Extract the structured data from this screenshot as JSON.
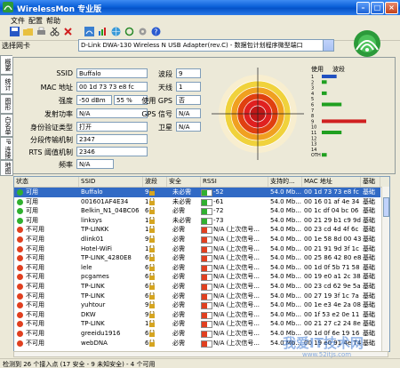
{
  "window": {
    "title": "WirelessMon 专业版",
    "min": "–",
    "max": "□",
    "close": "×"
  },
  "menu": [
    "文件",
    "配置",
    "帮助"
  ],
  "toolbar": {
    "icons": [
      "save-icon",
      "folder-icon",
      "print-icon",
      "scissors-icon",
      "copy-icon",
      "paste-icon",
      "delete-icon",
      "wifi-icon",
      "refresh-icon",
      "globe-icon",
      "gear-icon",
      "help-icon"
    ]
  },
  "adapter": {
    "label": "选择网卡",
    "value": "D-Link DWA-130 Wireless N USB Adapter(rev.C) - 数据包计划程序微型端口"
  },
  "tabs": [
    "概要",
    "统计",
    "图形",
    "白名单",
    "IP 连接",
    "地图"
  ],
  "fields": {
    "ssid_label": "SSID",
    "ssid": "Buffalo",
    "mac_label": "MAC 地址",
    "mac": "00 1d 73 73 e8 fc",
    "strength_label": "强度",
    "strength_dbm": "-50 dBm",
    "strength_pct": "55 %",
    "tx_label": "发射功率",
    "tx": "N/A",
    "auth_label": "身份验证类型",
    "auth": "打开",
    "frag_label": "分段传输机制",
    "frag": "2347",
    "rts_label": "RTS 阈值机制",
    "rts": "2346",
    "freq_label": "频率",
    "freq": "N/A",
    "channel_label": "波段",
    "channel": "9",
    "antenna_label": "天线",
    "antenna": "1",
    "gps_label": "使用 GPS",
    "gps": "否",
    "gpssig_label": "GPS 信号",
    "gpssig": "N/A",
    "sat_label": "卫星",
    "sat": "N/A"
  },
  "channel_chart": {
    "header_use": "使用",
    "header_band": "波段",
    "channels": [
      "1",
      "2",
      "3",
      "4",
      "5",
      "6",
      "7",
      "8",
      "9",
      "10",
      "11",
      "12",
      "13",
      "14",
      "OTH"
    ],
    "usage": [
      3,
      1,
      0,
      1,
      0,
      4,
      0,
      0,
      9,
      0,
      4,
      0,
      0,
      0,
      1
    ],
    "colors": [
      "#2050c0",
      "#20a020",
      "#20a020",
      "#20a020",
      "#20a020",
      "#20a020",
      "#20a020",
      "#20a020",
      "#d02020",
      "#20a020",
      "#20a020",
      "#20a020",
      "#20a020",
      "#20a020",
      "#20a020"
    ]
  },
  "grid": {
    "headers": [
      "状态",
      "SSID",
      "波段",
      "安全",
      "RSSI",
      "支持的...",
      "MAC 地址",
      "基础"
    ],
    "rows": [
      {
        "status": "可用",
        "color": "#30b030",
        "ssid": "Buffalo",
        "ch": "9",
        "sec": "未必需",
        "rssi": "-52",
        "rate": "54.0 Mb...",
        "mac": "00 1d 73 73 e8 fc",
        "mode": "基础",
        "bar": "#30b030",
        "sel": true
      },
      {
        "status": "可用",
        "color": "#30b030",
        "ssid": "001601AF4E34",
        "ch": "1",
        "sec": "未必需",
        "rssi": "-61",
        "rate": "54.0 Mb...",
        "mac": "00 16 01 af 4e 34",
        "mode": "基础",
        "bar": "#30b030"
      },
      {
        "status": "可用",
        "color": "#30b030",
        "ssid": "Belkin_N1_04BC06",
        "ch": "6",
        "sec": "必需",
        "rssi": "-72",
        "rate": "54.0 Mb...",
        "mac": "00 1c df 04 bc 06",
        "mode": "基础",
        "bar": "#30b030"
      },
      {
        "status": "可用",
        "color": "#30b030",
        "ssid": "linksys",
        "ch": "11",
        "sec": "未必需",
        "rssi": "-73",
        "rate": "54.0 Mb...",
        "mac": "00 21 29 b1 c9 9d",
        "mode": "基础",
        "bar": "#30b030"
      },
      {
        "status": "不可用",
        "color": "#e04020",
        "ssid": "TP-LINKK",
        "ch": "1",
        "sec": "必需",
        "rssi": "N/A (上次信号...",
        "rate": "54.0 Mb...",
        "mac": "00 23 cd 4d 4f 6c",
        "mode": "基础",
        "bar": "#e04020"
      },
      {
        "status": "不可用",
        "color": "#e04020",
        "ssid": "dlink01",
        "ch": "9",
        "sec": "必需",
        "rssi": "N/A (上次信号...",
        "rate": "54.0 Mb...",
        "mac": "00 1e 58 8d 00 43",
        "mode": "基础",
        "bar": "#e04020"
      },
      {
        "status": "不可用",
        "color": "#e04020",
        "ssid": "Hotel-WiFi",
        "ch": "11",
        "sec": "必需",
        "rssi": "N/A (上次信号...",
        "rate": "54.0 Mb...",
        "mac": "00 21 91 9d 3f 1c",
        "mode": "基础",
        "bar": "#e04020"
      },
      {
        "status": "不可用",
        "color": "#e04020",
        "ssid": "TP-LINK_4280E8",
        "ch": "6",
        "sec": "必需",
        "rssi": "N/A (上次信号...",
        "rate": "54.0 Mb...",
        "mac": "00 25 86 42 80 e8",
        "mode": "基础",
        "bar": "#e04020"
      },
      {
        "status": "不可用",
        "color": "#e04020",
        "ssid": "lele",
        "ch": "6",
        "sec": "必需",
        "rssi": "N/A (上次信号...",
        "rate": "54.0 Mb...",
        "mac": "00 1d 0f 5b 71 58",
        "mode": "基础",
        "bar": "#e04020"
      },
      {
        "status": "不可用",
        "color": "#e04020",
        "ssid": "pcgames",
        "ch": "6",
        "sec": "必需",
        "rssi": "N/A (上次信号...",
        "rate": "54.0 Mb...",
        "mac": "00 19 e0 a1 2c 38",
        "mode": "基础",
        "bar": "#e04020"
      },
      {
        "status": "不可用",
        "color": "#e04020",
        "ssid": "TP-LINK",
        "ch": "6",
        "sec": "必需",
        "rssi": "N/A (上次信号...",
        "rate": "54.0 Mb...",
        "mac": "00 23 cd 62 9e 5a",
        "mode": "基础",
        "bar": "#e04020"
      },
      {
        "status": "不可用",
        "color": "#e04020",
        "ssid": "TP-LINK",
        "ch": "6",
        "sec": "必需",
        "rssi": "N/A (上次信号...",
        "rate": "54.0 Mb...",
        "mac": "00 27 19 3f 1c 7a",
        "mode": "基础",
        "bar": "#e04020"
      },
      {
        "status": "不可用",
        "color": "#e04020",
        "ssid": "yuhtour",
        "ch": "9",
        "sec": "必需",
        "rssi": "N/A (上次信号...",
        "rate": "54.0 Mb...",
        "mac": "00 1e e3 4e 2a 08",
        "mode": "基础",
        "bar": "#e04020"
      },
      {
        "status": "不可用",
        "color": "#e04020",
        "ssid": "DKW",
        "ch": "9",
        "sec": "必需",
        "rssi": "N/A (上次信号...",
        "rate": "54.0 Mb...",
        "mac": "00 1f 53 e2 0e 11",
        "mode": "基础",
        "bar": "#e04020"
      },
      {
        "status": "不可用",
        "color": "#e04020",
        "ssid": "TP-LINK",
        "ch": "11",
        "sec": "必需",
        "rssi": "N/A (上次信号...",
        "rate": "54.0 Mb...",
        "mac": "00 21 27 c2 24 8e",
        "mode": "基础",
        "bar": "#e04020"
      },
      {
        "status": "不可用",
        "color": "#e04020",
        "ssid": "greeidu1916",
        "ch": "6",
        "sec": "必需",
        "rssi": "N/A (上次信号...",
        "rate": "54.0 Mb...",
        "mac": "00 1d 0f 6e 19 16",
        "mode": "基础",
        "bar": "#e04020"
      },
      {
        "status": "不可用",
        "color": "#e04020",
        "ssid": "webDNA",
        "ch": "6",
        "sec": "必需",
        "rssi": "N/A (上次信号...",
        "rate": "54.0 Mb...",
        "mac": "00 19 e0 91 4e 74",
        "mode": "基础",
        "bar": "#e04020"
      }
    ]
  },
  "status": "检测到 26 个接入点 (17 安全 - 9 未知安全) - 4 个可用",
  "watermark": "我爱IT技术网",
  "watermark_url": "www.52itjs.com"
}
